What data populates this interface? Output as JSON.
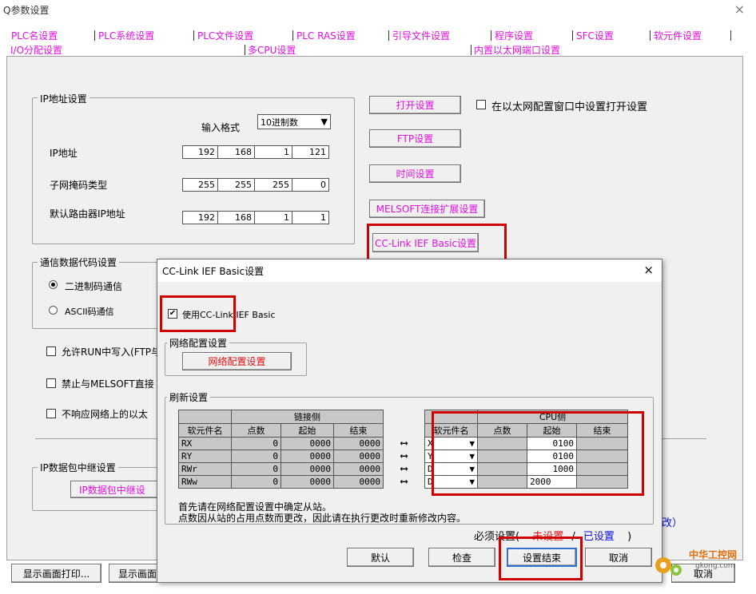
{
  "window": {
    "title": "Q参数设置",
    "close_glyph": "×"
  },
  "tabs_row1": [
    "PLC名设置",
    "PLC系统设置",
    "PLC文件设置",
    "PLC RAS设置",
    "引导文件设置",
    "程序设置",
    "SFC设置",
    "软元件设置"
  ],
  "tabs_row2": [
    "I/O分配设置",
    "多CPU设置",
    "内置以太网端口设置"
  ],
  "ip_group": {
    "title": "IP地址设置",
    "input_format_label": "输入格式",
    "input_format_value": "10进制数",
    "ip_label": "IP地址",
    "ip": [
      "192",
      "168",
      "1",
      "121"
    ],
    "mask_label": "子网掩码类型",
    "mask": [
      "255",
      "255",
      "255",
      "0"
    ],
    "gateway_label": "默认路由器IP地址",
    "gateway": [
      "192",
      "168",
      "1",
      "1"
    ]
  },
  "right_buttons": {
    "open_settings": "打开设置",
    "ftp": "FTP设置",
    "time": "时间设置",
    "melsoft_ext": "MELSOFT连接扩展设置",
    "cclink": "CC-Link IEF Basic设置",
    "open_in_ethernet_label": "在以太网配置窗口中设置打开设置"
  },
  "comm_group": {
    "title": "通信数据代码设置",
    "binary": "二进制码通信",
    "ascii": "ASCII码通信"
  },
  "checks": {
    "allow_run_write": "允许RUN中写入(FTP与",
    "forbid_melsoft": "禁止与MELSOFT直接",
    "no_respond": "不响应网络上的以太"
  },
  "relay_group": {
    "title": "IP数据包中继设置",
    "button": "IP数据包中继设"
  },
  "bottom": {
    "print_button": "显示画面打印...",
    "preview_button": "显示画面",
    "partial_text": "改）",
    "cancel_partial": "取消"
  },
  "dialog": {
    "title": "CC-Link IEF Basic设置",
    "close_glyph": "×",
    "use_label": "使用CC-Link IEF Basic",
    "network_group_title": "网络配置设置",
    "network_button": "网络配置设置",
    "refresh_group_title": "刷新设置",
    "link_side": "链接侧",
    "cpu_side": "CPU侧",
    "headers": {
      "device_name": "软元件名",
      "points": "点数",
      "start": "起始",
      "end": "结束"
    },
    "link_rows": [
      {
        "name": "RX",
        "points": "0",
        "start": "0000",
        "end": "0000"
      },
      {
        "name": "RY",
        "points": "0",
        "start": "0000",
        "end": "0000"
      },
      {
        "name": "RWr",
        "points": "0",
        "start": "0000",
        "end": "0000"
      },
      {
        "name": "RWw",
        "points": "0",
        "start": "0000",
        "end": "0000"
      }
    ],
    "cpu_rows": [
      {
        "device": "X",
        "points": "",
        "start": "0100",
        "end": ""
      },
      {
        "device": "Y",
        "points": "",
        "start": "0100",
        "end": ""
      },
      {
        "device": "D",
        "points": "",
        "start": "1000",
        "end": ""
      },
      {
        "device": "D",
        "points": "",
        "start": "2000",
        "end": ""
      }
    ],
    "note1": "首先请在网络配置设置中确定从站。",
    "note2": "点数因从站的占用点数而更改，因此请在执行更改时重新修改内容。",
    "legend_prefix": "必须设置(",
    "legend_unset": "未设置",
    "legend_slash": "/",
    "legend_set": "已设置",
    "legend_suffix": ")",
    "btn_default": "默认",
    "btn_check": "检查",
    "btn_finish": "设置结束",
    "btn_cancel": "取消"
  },
  "watermark": {
    "line1": "中华工控网",
    "line2": "gkong.com"
  },
  "colors": {
    "tab_text": "#e010e0",
    "highlight_box": "#d00000",
    "set_blue": "#1010e0",
    "unset_red": "#e01010"
  }
}
